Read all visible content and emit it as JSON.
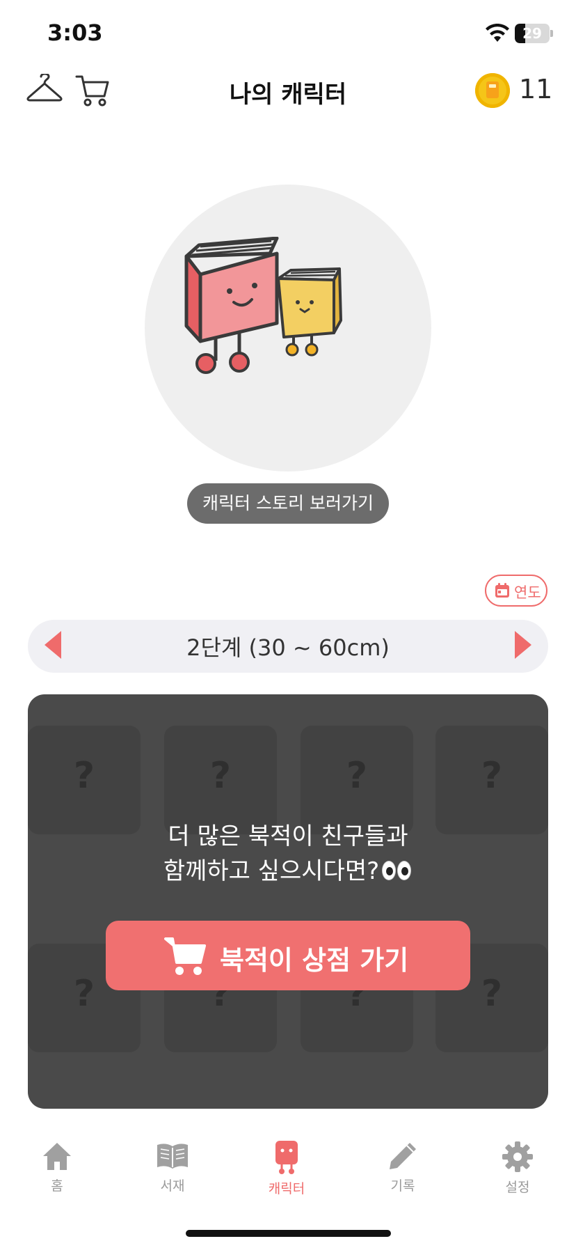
{
  "status_bar": {
    "time": "3:03",
    "battery": "29",
    "battery_level": 0.29
  },
  "header": {
    "title": "나의 캐릭터",
    "coin_count": "11"
  },
  "character": {
    "story_button": "캐릭터 스토리 보러가기"
  },
  "filter": {
    "year_label": "연도"
  },
  "stage": {
    "label": "2단계 (30 ~ 60cm)"
  },
  "locked_grid": {
    "slots": [
      "?",
      "?",
      "?",
      "?",
      "?",
      "?",
      "?",
      "?"
    ],
    "message_line1": "더 많은 북적이 친구들과",
    "message_line2": "함께하고 싶으시다면?",
    "shop_button": "북적이 상점 가기"
  },
  "tabs": [
    {
      "label": "홈",
      "icon": "home-icon",
      "active": false
    },
    {
      "label": "서재",
      "icon": "book-icon",
      "active": false
    },
    {
      "label": "캐릭터",
      "icon": "character-icon",
      "active": true
    },
    {
      "label": "기록",
      "icon": "pencil-icon",
      "active": false
    },
    {
      "label": "설정",
      "icon": "gear-icon",
      "active": false
    }
  ],
  "colors": {
    "accent": "#f07070",
    "panel": "#4a4a4a",
    "coin": "#f5c518"
  }
}
